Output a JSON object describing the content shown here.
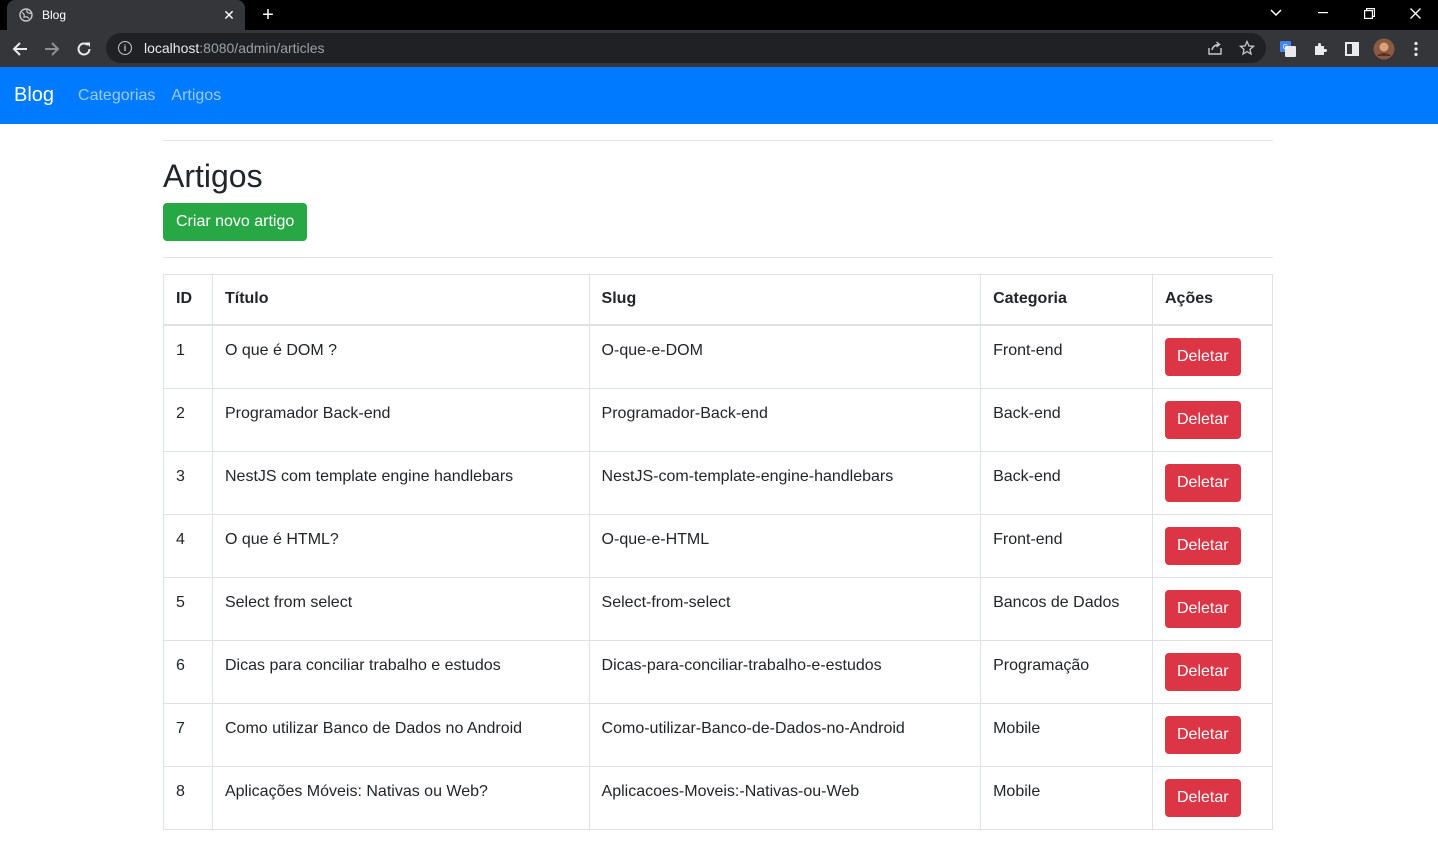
{
  "browser": {
    "tab_title": "Blog",
    "url_host": "localhost",
    "url_path": ":8080/admin/articles"
  },
  "navbar": {
    "brand": "Blog",
    "links": [
      "Categorias",
      "Artigos"
    ],
    "color": "#007bff"
  },
  "page": {
    "title": "Artigos",
    "create_button": "Criar novo artigo"
  },
  "table": {
    "headers": [
      "ID",
      "Título",
      "Slug",
      "Categoria",
      "Ações"
    ],
    "delete_label": "Deletar",
    "rows": [
      {
        "id": "1",
        "title": "O que é DOM ?",
        "slug": "O-que-e-DOM",
        "category": "Front-end"
      },
      {
        "id": "2",
        "title": "Programador Back-end",
        "slug": "Programador-Back-end",
        "category": "Back-end"
      },
      {
        "id": "3",
        "title": "NestJS com template engine handlebars",
        "slug": "NestJS-com-template-engine-handlebars",
        "category": "Back-end"
      },
      {
        "id": "4",
        "title": "O que é HTML?",
        "slug": "O-que-e-HTML",
        "category": "Front-end"
      },
      {
        "id": "5",
        "title": "Select from select",
        "slug": "Select-from-select",
        "category": "Bancos de Dados"
      },
      {
        "id": "6",
        "title": "Dicas para conciliar trabalho e estudos",
        "slug": "Dicas-para-conciliar-trabalho-e-estudos",
        "category": "Programação"
      },
      {
        "id": "7",
        "title": "Como utilizar Banco de Dados no Android",
        "slug": "Como-utilizar-Banco-de-Dados-no-Android",
        "category": "Mobile"
      },
      {
        "id": "8",
        "title": "Aplicações Móveis: Nativas ou Web?",
        "slug": "Aplicacoes-Moveis:-Nativas-ou-Web",
        "category": "Mobile"
      }
    ]
  },
  "colors": {
    "success": "#28a745",
    "danger": "#dc3545"
  }
}
